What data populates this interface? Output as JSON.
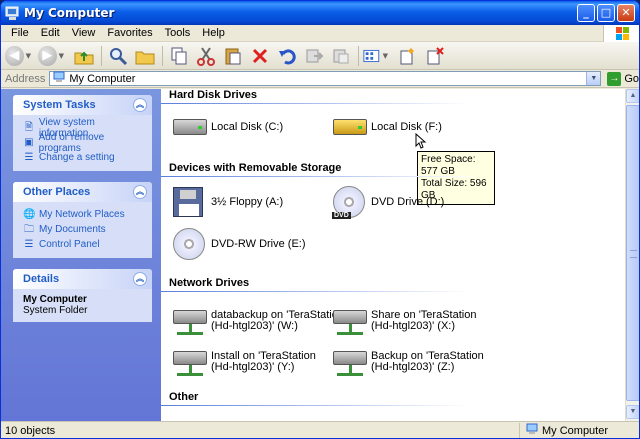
{
  "window": {
    "title": "My Computer",
    "buttons": {
      "minimize": "_",
      "maximize": "□",
      "close": "✕"
    }
  },
  "menu": {
    "items": [
      "File",
      "Edit",
      "View",
      "Favorites",
      "Tools",
      "Help"
    ]
  },
  "toolbar": {
    "icons": [
      "back-icon",
      "forward-icon",
      "up-folder-icon",
      "search-icon",
      "folders-icon",
      "copy-to-icon",
      "cut-icon",
      "paste-icon",
      "delete-icon",
      "undo-icon",
      "move-to-icon",
      "views-icon",
      "properties-icon",
      "disconnect-icon"
    ]
  },
  "address": {
    "label": "Address",
    "value": "My Computer",
    "go_label": "Go"
  },
  "sidebar": {
    "system_tasks": {
      "title": "System Tasks",
      "items": [
        "View system information",
        "Add or remove programs",
        "Change a setting"
      ]
    },
    "other_places": {
      "title": "Other Places",
      "items": [
        "My Network Places",
        "My Documents",
        "Control Panel"
      ]
    },
    "details": {
      "title": "Details",
      "name": "My Computer",
      "type": "System Folder"
    }
  },
  "groups": {
    "hard_disk": {
      "title": "Hard Disk Drives",
      "items": [
        "Local Disk (C:)",
        "Local Disk (F:)"
      ]
    },
    "removable": {
      "title": "Devices with Removable Storage",
      "items": [
        "3½ Floppy (A:)",
        "DVD Drive (D:)",
        "DVD-RW Drive (E:)"
      ]
    },
    "network": {
      "title": "Network Drives",
      "items": [
        {
          "line1": "databackup on 'TeraStation",
          "line2": "(Hd-htgl203)' (W:)"
        },
        {
          "line1": "Share on 'TeraStation",
          "line2": "(Hd-htgl203)' (X:)"
        },
        {
          "line1": "Install on 'TeraStation",
          "line2": "(Hd-htgl203)' (Y:)"
        },
        {
          "line1": "Backup on 'TeraStation",
          "line2": "(Hd-htgl203)' (Z:)"
        }
      ]
    },
    "other": {
      "title": "Other"
    }
  },
  "tooltip": {
    "free_space": "Free Space: 577 GB",
    "total_size": "Total Size: 596 GB"
  },
  "dvd_badge": "DVD",
  "status": {
    "objects": "10 objects",
    "location": "My Computer"
  }
}
